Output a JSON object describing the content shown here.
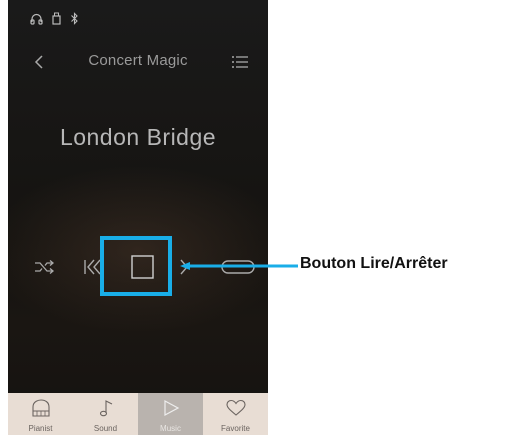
{
  "app": {
    "title": "Concert Magic",
    "song_title": "London Bridge"
  },
  "status_icons": [
    "headphones-icon",
    "usb-icon",
    "bluetooth-icon"
  ],
  "controls": {
    "shuffle": "shuffle-icon",
    "previous": "skip-back-icon",
    "play_stop": "stop-icon",
    "next": "skip-forward-icon",
    "repeat": "repeat-icon"
  },
  "callout": {
    "label": "Bouton Lire/Arrêter",
    "color": "#19aee8"
  },
  "tabs": [
    {
      "label": "Pianist",
      "icon": "piano-icon",
      "active": false
    },
    {
      "label": "Sound",
      "icon": "music-note-icon",
      "active": false
    },
    {
      "label": "Music",
      "icon": "play-icon",
      "active": true
    },
    {
      "label": "Favorite",
      "icon": "heart-icon",
      "active": false
    }
  ]
}
